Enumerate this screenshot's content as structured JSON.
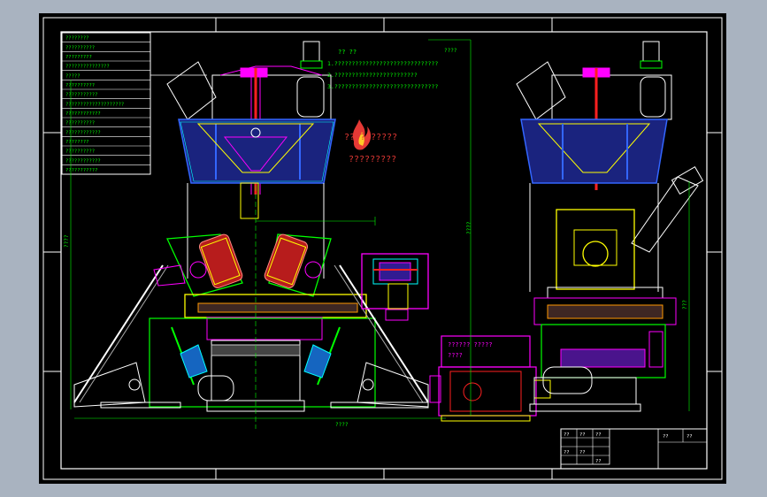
{
  "notes": {
    "title": "??  ??",
    "lines": [
      "1.??????????????????????????????",
      "2.????????????????????????",
      "3.??????????????????????????????"
    ]
  },
  "watermark": {
    "line1": "??????????",
    "line2": "?????????"
  },
  "motor_label": {
    "line1": "??????  ?????",
    "line2": "????"
  },
  "spec_rows": [
    "????????",
    "??????????",
    "?????????",
    "???????????????",
    "?????",
    "??????????",
    "???????????",
    "????????????????????",
    "????????????",
    "??????????",
    "????????????",
    "????????",
    "??????????",
    "????????????",
    "???????????"
  ],
  "dimensions": {
    "height_left": "????",
    "height_center": "????",
    "height_right": "???",
    "top_width": "????",
    "base_width": "????"
  },
  "title_block": {
    "cells": [
      "??",
      "??",
      "??",
      "??",
      "??",
      "??"
    ],
    "right_cells": [
      "??",
      "??"
    ]
  },
  "colors": {
    "background": "#000000",
    "frame": "#ffffff",
    "accent_green": "#00ff00",
    "accent_yellow": "#ffff00",
    "accent_magenta": "#ff00ff",
    "accent_cyan": "#00ffff",
    "accent_blue": "#3366ff",
    "accent_red": "#ff2020"
  }
}
